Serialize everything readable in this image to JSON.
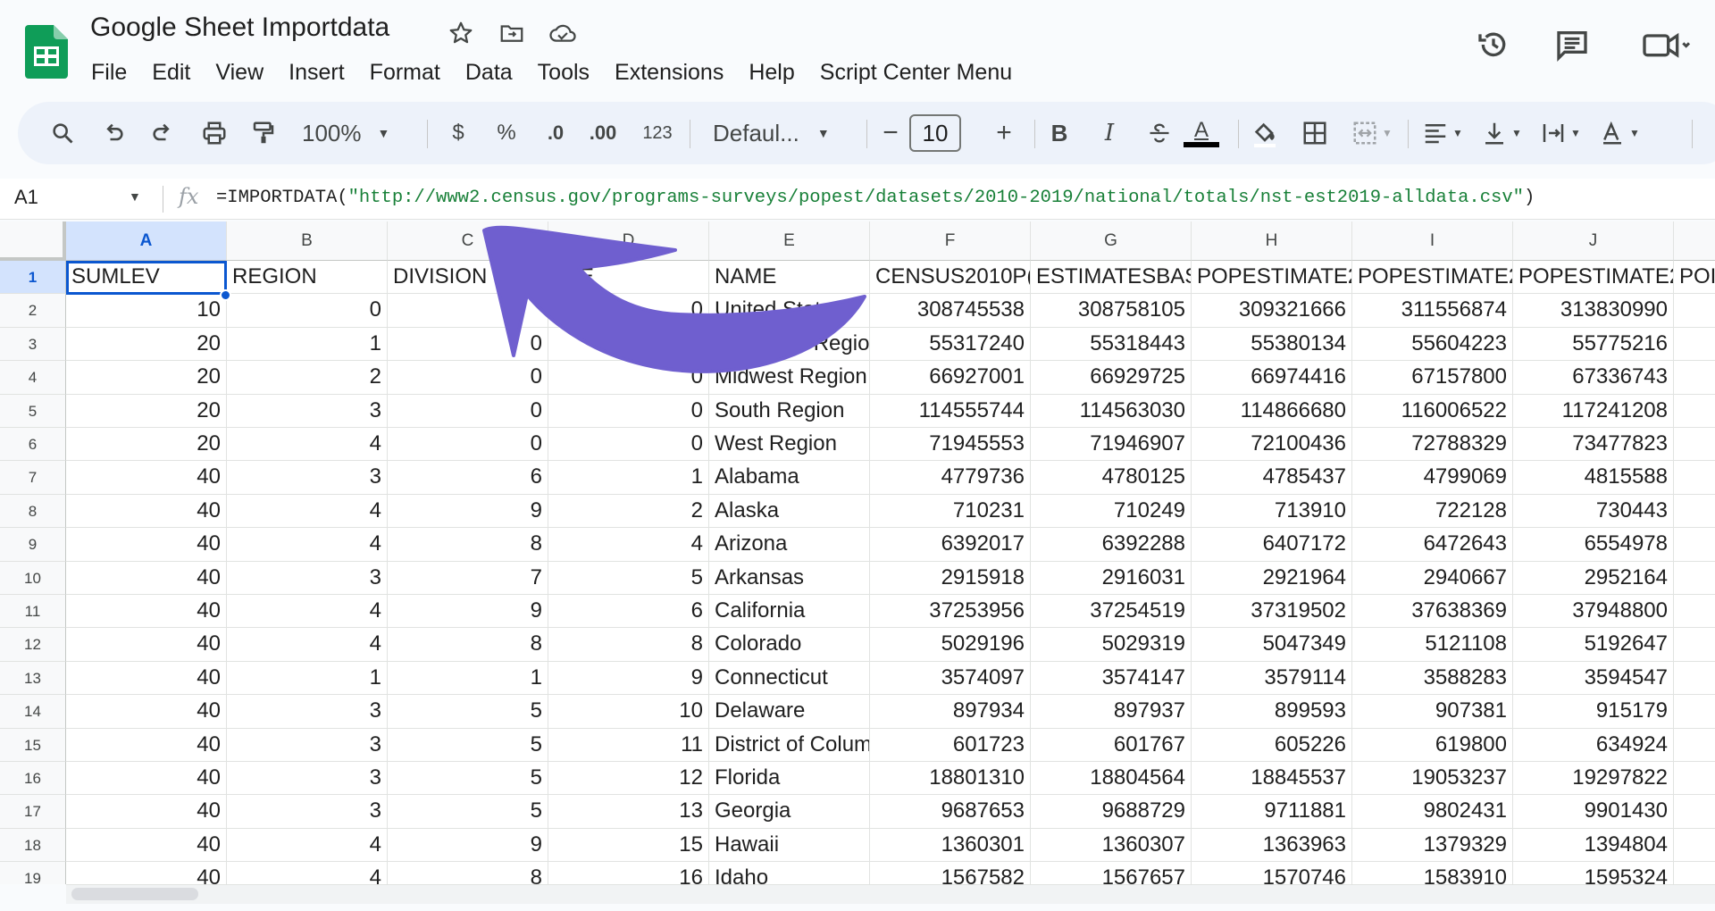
{
  "header": {
    "title": "Google Sheet Importdata",
    "menu": [
      "File",
      "Edit",
      "View",
      "Insert",
      "Format",
      "Data",
      "Tools",
      "Extensions",
      "Help",
      "Script Center Menu"
    ]
  },
  "toolbar": {
    "zoom": "100%",
    "currency": "$",
    "percent": "%",
    "decrease_decimal": ".0",
    "increase_decimal": ".00",
    "number_format": "123",
    "font": "Defaul...",
    "font_size": "10",
    "minus": "−",
    "plus": "+",
    "bold": "B",
    "italic": "I",
    "text_color_letter": "A"
  },
  "formula_bar": {
    "cell_ref": "A1",
    "fx": "fx",
    "formula_prefix": "=IMPORTDATA(",
    "formula_url": "\"http://www2.census.gov/programs-surveys/popest/datasets/2010-2019/national/totals/nst-est2019-alldata.csv\"",
    "formula_suffix": ")"
  },
  "grid": {
    "columns": [
      "A",
      "B",
      "C",
      "D",
      "E",
      "F",
      "G",
      "H",
      "I",
      "J"
    ],
    "row_numbers": [
      "1",
      "2",
      "3",
      "4",
      "5",
      "6",
      "7",
      "8",
      "9",
      "10",
      "11",
      "12",
      "13",
      "14",
      "15",
      "16",
      "17",
      "18",
      "19"
    ],
    "header_row": [
      "SUMLEV",
      "REGION",
      "DIVISION",
      "ATE",
      "NAME",
      "CENSUS2010P(",
      "ESTIMATESBAS",
      "POPESTIMATE2",
      "POPESTIMATE2",
      "POPESTIMATE2",
      "POI"
    ],
    "rows": [
      [
        "10",
        "0",
        "",
        "0",
        "United States",
        "308745538",
        "308758105",
        "309321666",
        "311556874",
        "313830990"
      ],
      [
        "20",
        "1",
        "0",
        "",
        "Northeast Regio",
        "55317240",
        "55318443",
        "55380134",
        "55604223",
        "55775216"
      ],
      [
        "20",
        "2",
        "0",
        "0",
        "Midwest Region",
        "66927001",
        "66929725",
        "66974416",
        "67157800",
        "67336743"
      ],
      [
        "20",
        "3",
        "0",
        "0",
        "South Region",
        "114555744",
        "114563030",
        "114866680",
        "116006522",
        "117241208"
      ],
      [
        "20",
        "4",
        "0",
        "0",
        "West Region",
        "71945553",
        "71946907",
        "72100436",
        "72788329",
        "73477823"
      ],
      [
        "40",
        "3",
        "6",
        "1",
        "Alabama",
        "4779736",
        "4780125",
        "4785437",
        "4799069",
        "4815588"
      ],
      [
        "40",
        "4",
        "9",
        "2",
        "Alaska",
        "710231",
        "710249",
        "713910",
        "722128",
        "730443"
      ],
      [
        "40",
        "4",
        "8",
        "4",
        "Arizona",
        "6392017",
        "6392288",
        "6407172",
        "6472643",
        "6554978"
      ],
      [
        "40",
        "3",
        "7",
        "5",
        "Arkansas",
        "2915918",
        "2916031",
        "2921964",
        "2940667",
        "2952164"
      ],
      [
        "40",
        "4",
        "9",
        "6",
        "California",
        "37253956",
        "37254519",
        "37319502",
        "37638369",
        "37948800"
      ],
      [
        "40",
        "4",
        "8",
        "8",
        "Colorado",
        "5029196",
        "5029319",
        "5047349",
        "5121108",
        "5192647"
      ],
      [
        "40",
        "1",
        "1",
        "9",
        "Connecticut",
        "3574097",
        "3574147",
        "3579114",
        "3588283",
        "3594547"
      ],
      [
        "40",
        "3",
        "5",
        "10",
        "Delaware",
        "897934",
        "897937",
        "899593",
        "907381",
        "915179"
      ],
      [
        "40",
        "3",
        "5",
        "11",
        "District of Colum",
        "601723",
        "601767",
        "605226",
        "619800",
        "634924"
      ],
      [
        "40",
        "3",
        "5",
        "12",
        "Florida",
        "18801310",
        "18804564",
        "18845537",
        "19053237",
        "19297822"
      ],
      [
        "40",
        "3",
        "5",
        "13",
        "Georgia",
        "9687653",
        "9688729",
        "9711881",
        "9802431",
        "9901430"
      ],
      [
        "40",
        "4",
        "9",
        "15",
        "Hawaii",
        "1360301",
        "1360307",
        "1363963",
        "1379329",
        "1394804"
      ],
      [
        "40",
        "4",
        "8",
        "16",
        "Idaho",
        "1567582",
        "1567657",
        "1570746",
        "1583910",
        "1595324"
      ]
    ]
  },
  "colors": {
    "accent": "#0b57d0",
    "selection_bg": "#d3e3fd",
    "url_green": "#188038",
    "arrow": "#6f5fcf"
  }
}
